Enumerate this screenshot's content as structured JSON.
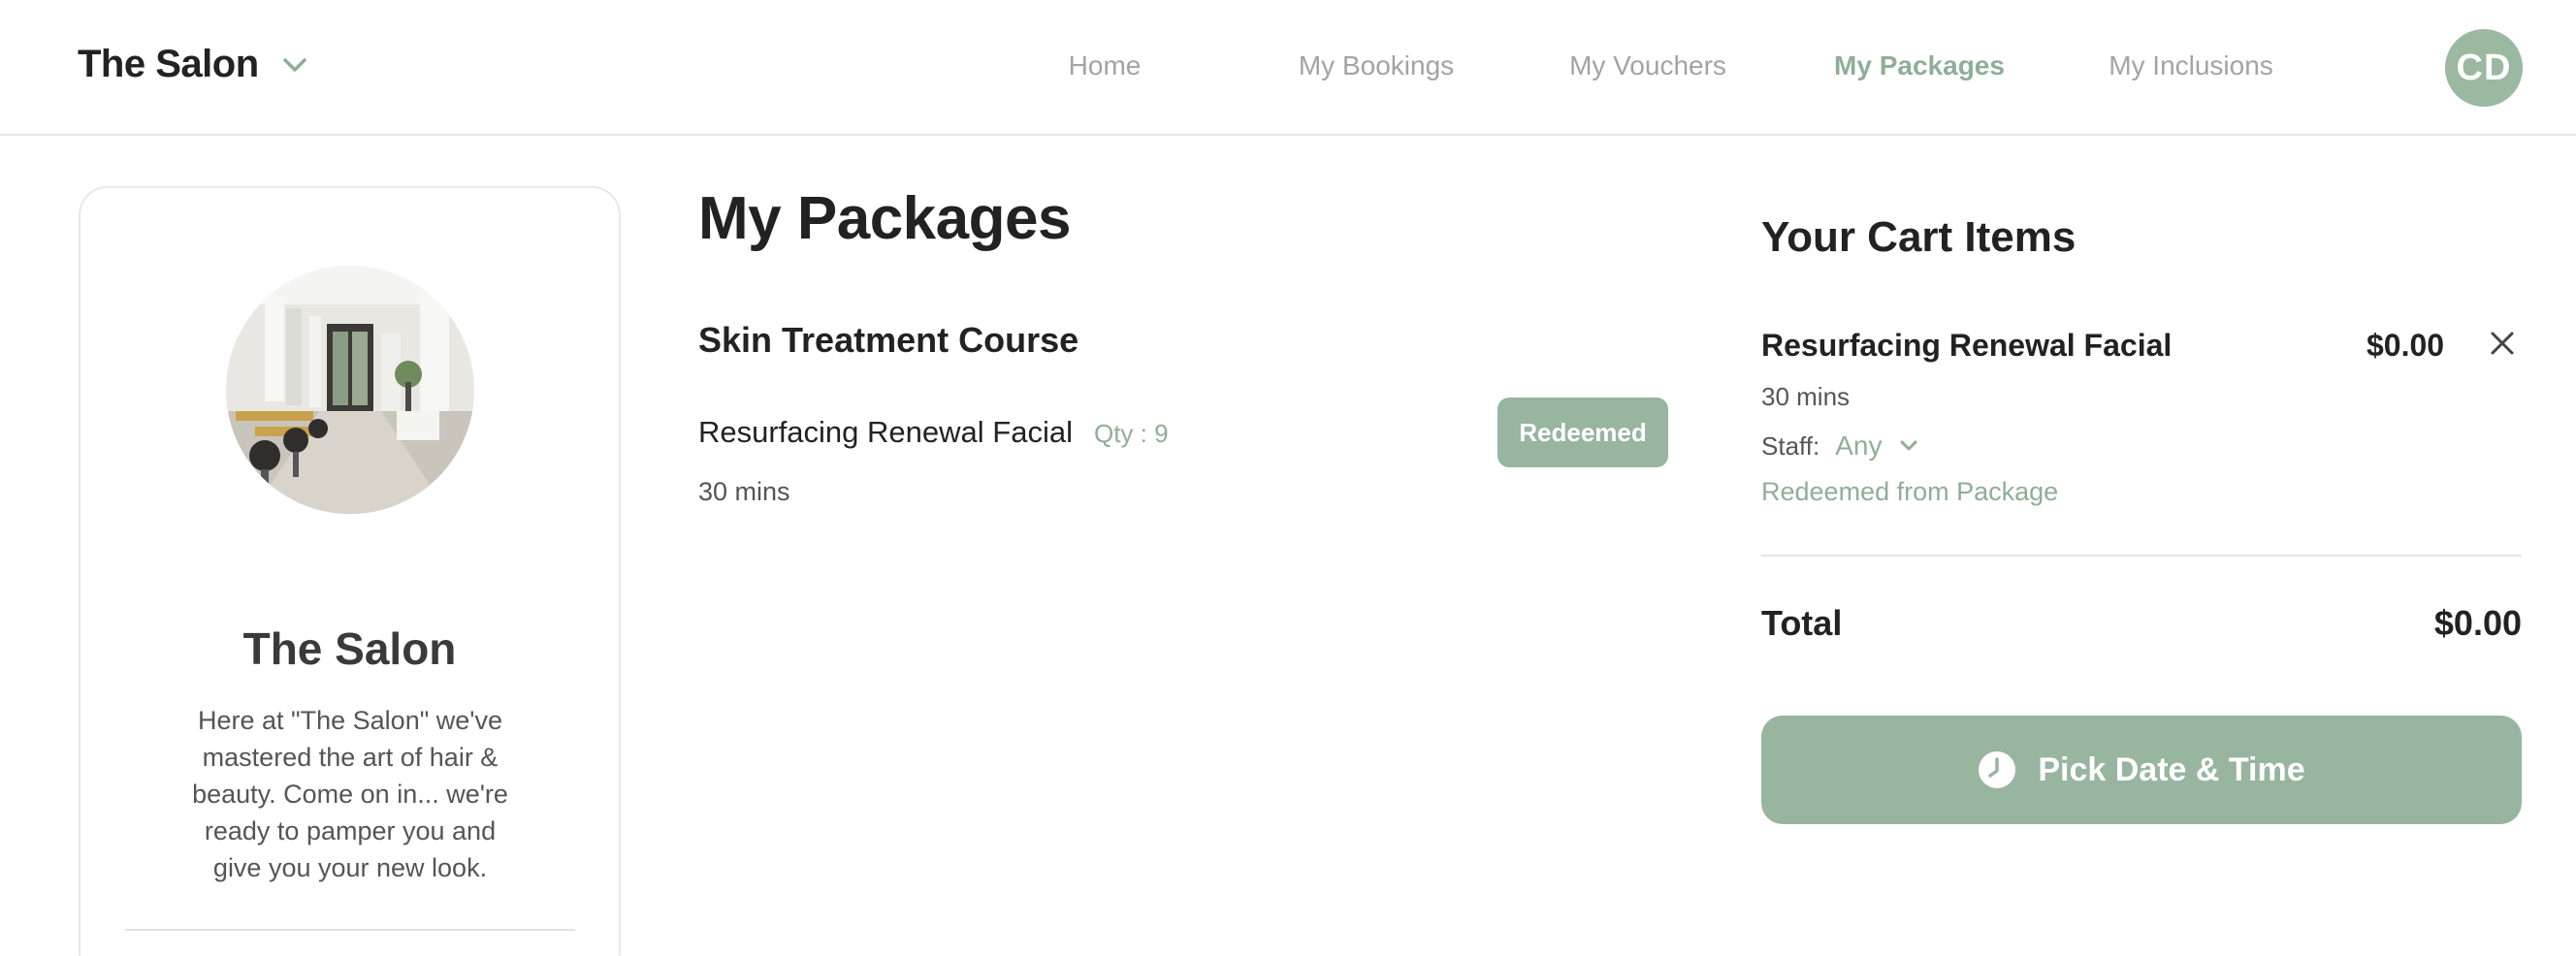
{
  "header": {
    "brand": "The Salon",
    "nav": [
      {
        "label": "Home",
        "active": false
      },
      {
        "label": "My Bookings",
        "active": false
      },
      {
        "label": "My Vouchers",
        "active": false
      },
      {
        "label": "My Packages",
        "active": true
      },
      {
        "label": "My Inclusions",
        "active": false
      }
    ],
    "avatar_initials": "CD"
  },
  "salon_card": {
    "title": "The Salon",
    "description": "Here at \"The Salon\" we've mastered the art of hair & beauty. Come on in... we're ready to pamper you and give you your new look."
  },
  "main": {
    "title": "My Packages",
    "package": {
      "name": "Skin Treatment Course",
      "item_name": "Resurfacing Renewal Facial",
      "qty": "Qty : 9",
      "duration": "30 mins",
      "status_label": "Redeemed"
    }
  },
  "cart": {
    "title": "Your Cart Items",
    "item": {
      "name": "Resurfacing Renewal Facial",
      "price": "$0.00",
      "duration": "30 mins",
      "staff_label": "Staff:",
      "staff_value": "Any",
      "note": "Redeemed from Package"
    },
    "total_label": "Total",
    "total_value": "$0.00",
    "action_label": "Pick Date & Time"
  },
  "colors": {
    "accent": "#8fae97",
    "button": "#97b59f",
    "text": "#222222",
    "muted": "#a3a3a3"
  },
  "icons": {
    "brand_dropdown": "chevron-down-icon",
    "remove": "close-icon",
    "staff_dropdown": "chevron-down-icon",
    "action": "clock-icon"
  }
}
